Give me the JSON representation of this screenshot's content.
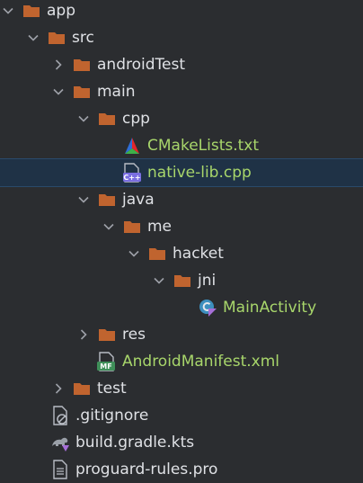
{
  "colors": {
    "background": "#2b2d30",
    "selection": "#1f3246",
    "folder": "#c0642f",
    "text": "#dfe1e5",
    "modified_text": "#a8d66b"
  },
  "tree": {
    "app": "app",
    "src": "src",
    "androidTest": "androidTest",
    "main": "main",
    "cpp": "cpp",
    "cmakelists": "CMakeLists.txt",
    "native_lib": "native-lib.cpp",
    "java": "java",
    "me": "me",
    "hacket": "hacket",
    "jni": "jni",
    "main_activity": "MainActivity",
    "res": "res",
    "manifest": "AndroidManifest.xml",
    "test": "test",
    "gitignore": ".gitignore",
    "build_gradle": "build.gradle.kts",
    "proguard": "proguard-rules.pro"
  },
  "icon_labels": {
    "cpp_badge": "C++",
    "manifest_badge": "MF"
  }
}
